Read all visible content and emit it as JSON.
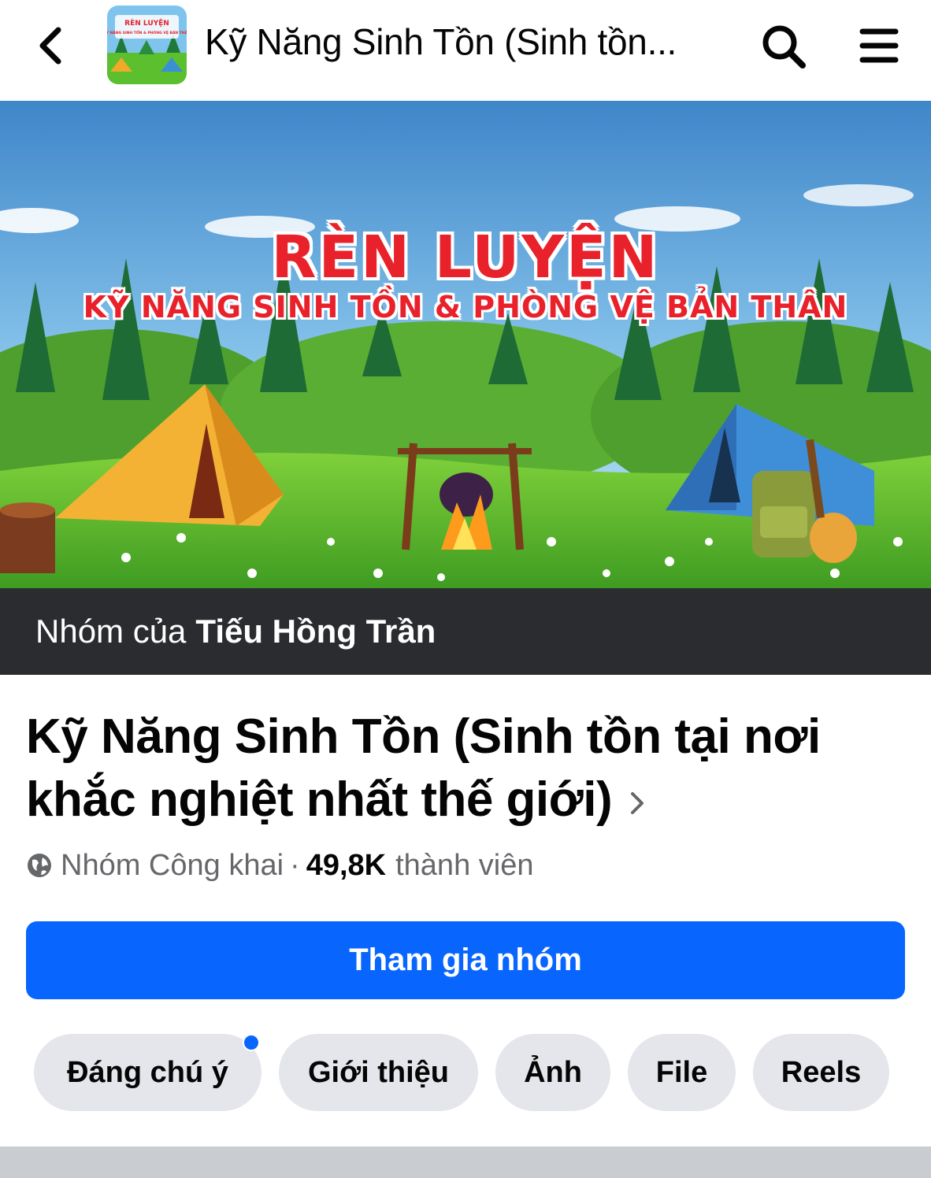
{
  "header": {
    "title": "Kỹ Năng Sinh Tồn (Sinh tồn...",
    "avatar_text_line1": "RÈN LUYỆN",
    "avatar_text_line2": "KỸ NĂNG SINH TỒN & PHÒNG VỆ BẢN THÂN",
    "back_icon": "chevron-left-icon",
    "search_icon": "search-icon",
    "menu_icon": "hamburger-menu-icon"
  },
  "cover": {
    "headline": "RÈN LUYỆN",
    "subheadline": "KỸ NĂNG SINH TỒN & PHÒNG VỆ BẢN THÂN"
  },
  "owner": {
    "prefix": "Nhóm của",
    "name": "Tiếu Hồng Trần"
  },
  "group": {
    "title_line1": "Kỹ Năng Sinh Tồn (Sinh tồn tại nơi",
    "title_line2": "khắc nghiệt nhất thế giới)",
    "privacy": "Nhóm Công khai",
    "separator": "·",
    "member_count": "49,8K",
    "member_label": "thành viên"
  },
  "actions": {
    "join_label": "Tham gia nhóm"
  },
  "tabs": [
    {
      "label": "Đáng chú ý",
      "has_notification": true
    },
    {
      "label": "Giới thiệu",
      "has_notification": false
    },
    {
      "label": "Ảnh",
      "has_notification": false
    },
    {
      "label": "File",
      "has_notification": false
    },
    {
      "label": "Reels",
      "has_notification": false
    }
  ],
  "colors": {
    "primary": "#0866ff",
    "owner_strip": "#2a2c2f",
    "tab_bg": "#e4e6eb",
    "cover_title": "#e8212b"
  }
}
